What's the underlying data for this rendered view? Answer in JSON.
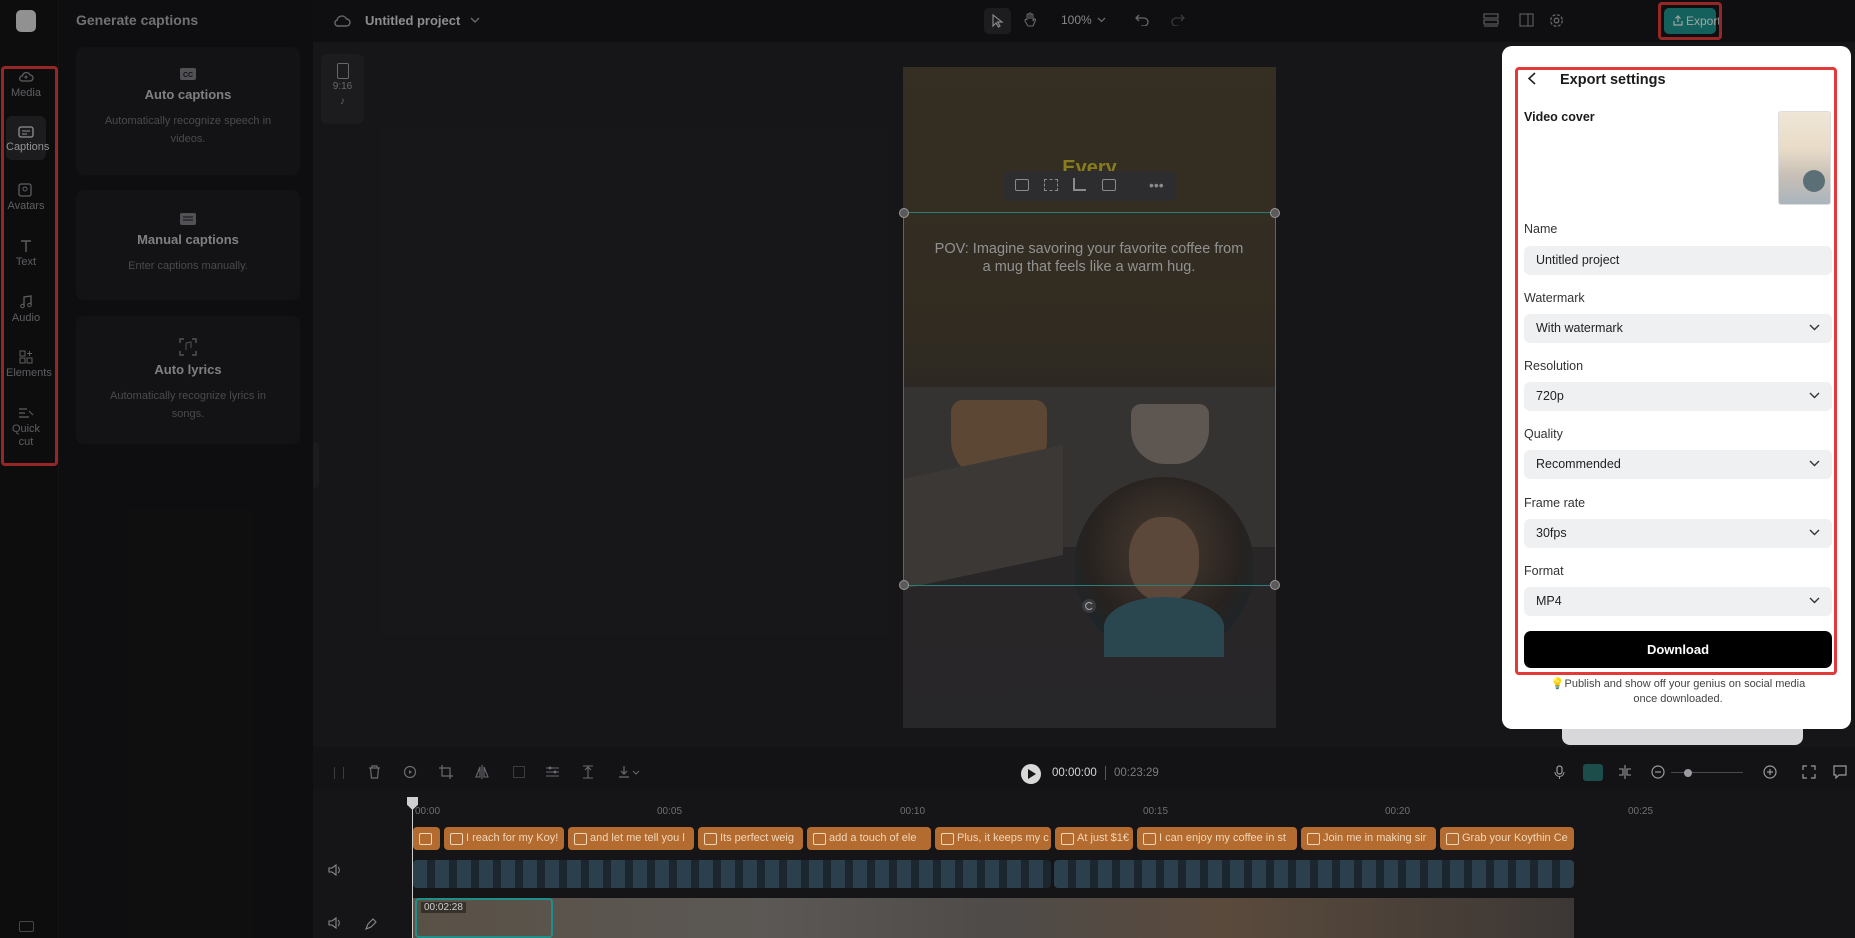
{
  "rail": {
    "items": [
      {
        "label": "Media",
        "icon": "cloud-upload-icon"
      },
      {
        "label": "Captions",
        "icon": "captions-icon"
      },
      {
        "label": "Avatars",
        "icon": "avatar-icon"
      },
      {
        "label": "Text",
        "icon": "text-icon"
      },
      {
        "label": "Audio",
        "icon": "music-note-icon"
      },
      {
        "label": "Elements",
        "icon": "elements-icon"
      },
      {
        "label": "Quick cut",
        "icon": "quick-cut-icon"
      }
    ],
    "active": "Captions"
  },
  "panel": {
    "title": "Generate captions",
    "cards": [
      {
        "title": "Auto captions",
        "desc": "Automatically recognize speech in videos.",
        "icon": "cc-icon"
      },
      {
        "title": "Manual captions",
        "desc": "Enter captions manually.",
        "icon": "keyboard-icon"
      },
      {
        "title": "Auto lyrics",
        "desc": "Automatically recognize lyrics in songs.",
        "icon": "lyrics-scan-icon"
      }
    ]
  },
  "topbar": {
    "project_name": "Untitled project",
    "zoom": "100%",
    "export_label": "Export"
  },
  "aspect": {
    "ratio": "9:16",
    "platform_icon": "tiktok-icon"
  },
  "video": {
    "title_text": "Every",
    "caption_text": "POV: Imagine savoring your favorite coffee from a mug that feels like a warm hug."
  },
  "export_panel": {
    "title": "Export settings",
    "video_cover_label": "Video cover",
    "name_label": "Name",
    "name_value": "Untitled project",
    "watermark_label": "Watermark",
    "watermark_value": "With watermark",
    "resolution_label": "Resolution",
    "resolution_value": "720p",
    "quality_label": "Quality",
    "quality_value": "Recommended",
    "framerate_label": "Frame rate",
    "framerate_value": "30fps",
    "format_label": "Format",
    "format_value": "MP4",
    "download_label": "Download",
    "hint": "Publish and show off your genius on social media once downloaded."
  },
  "timeline": {
    "current_time": "00:00:00",
    "total_time": "00:23:29",
    "ruler": [
      "00:00",
      "00:05",
      "00:10",
      "00:15",
      "00:20",
      "00:25"
    ],
    "caption_clips": [
      "I reach for my Koy!",
      "and let me tell you l",
      "Its perfect weig",
      "add a touch of ele",
      "Plus, it keeps my c",
      "At just $1€",
      "I can enjoy my coffee in st",
      "Join me in making sir",
      "Grab your Koythin Ce"
    ],
    "clip_duration": "00:02:28"
  },
  "colors": {
    "accent": "#1f8f8a",
    "highlight": "#e23a3a",
    "caption_clip": "#b36b2f"
  }
}
